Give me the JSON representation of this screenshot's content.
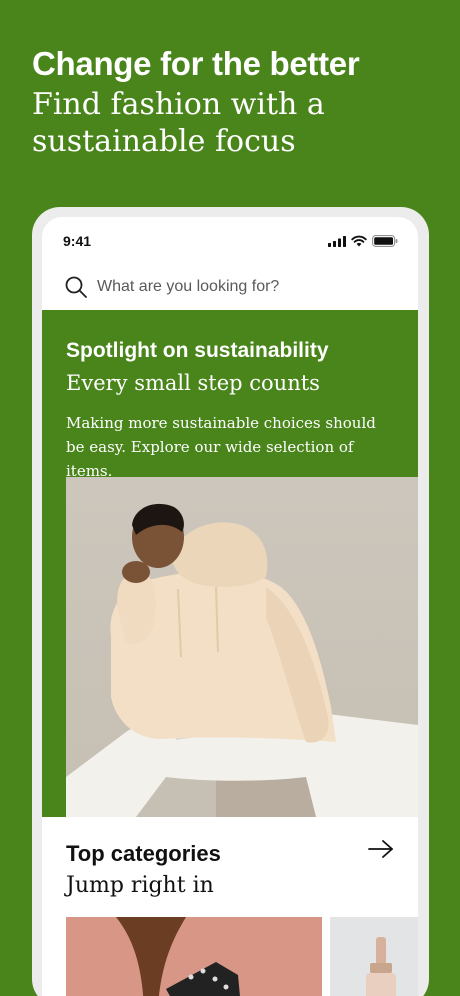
{
  "promo": {
    "title": "Change for the better",
    "subtitle_line1": "Find fashion with a",
    "subtitle_line2": "sustainable focus"
  },
  "status_bar": {
    "time": "9:41"
  },
  "search": {
    "placeholder": "What are you looking for?"
  },
  "spotlight": {
    "title": "Spotlight on sustainability",
    "subtitle": "Every small step counts",
    "body": "Making more sustainable choices should be easy. Explore our wide selection of items."
  },
  "categories": {
    "title": "Top categories",
    "subtitle": "Jump right in"
  },
  "colors": {
    "brand_green": "#4a851c",
    "text_dark": "#111111"
  }
}
